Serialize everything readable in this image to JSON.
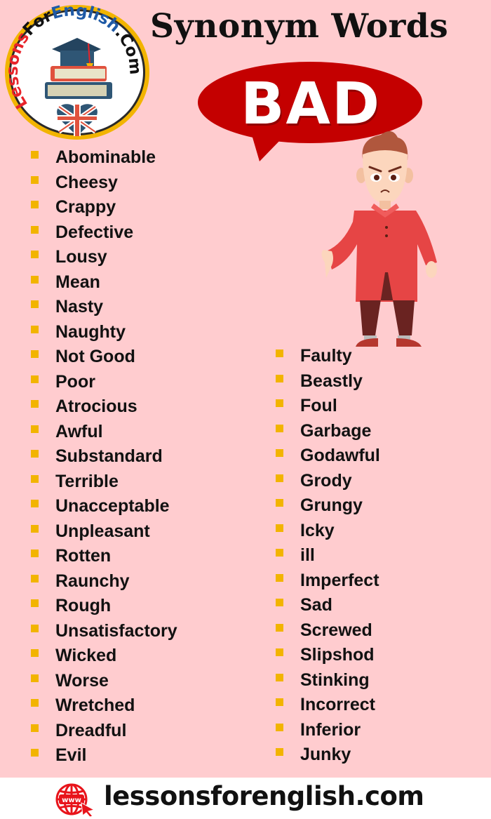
{
  "logo": {
    "text_lessons": "Lessons",
    "text_for": "For",
    "text_english": "English",
    "text_com": ".Com",
    "colors": {
      "lessons": "#e8232a",
      "for": "#111111",
      "english": "#1f5aa6",
      "ring": "#f2b400"
    }
  },
  "header": {
    "title": "Synonym Words",
    "keyword": "BAD",
    "bubble_color": "#c40000"
  },
  "word_lists": {
    "bullet_color": "#f2b400",
    "left": [
      "Abominable",
      "Cheesy",
      "Crappy",
      "Defective",
      "Lousy",
      "Mean",
      "Nasty",
      "Naughty",
      "Not Good",
      "Poor",
      "Atrocious",
      "Awful",
      "Substandard",
      "Terrible",
      "Unacceptable",
      "Unpleasant",
      "Rotten",
      "Raunchy",
      "Rough",
      "Unsatisfactory",
      "Wicked",
      "Worse",
      "Wretched",
      "Dreadful",
      "Evil"
    ],
    "right": [
      "Faulty",
      "Beastly",
      "Foul",
      "Garbage",
      "Godawful",
      "Grody",
      "Grungy",
      "Icky",
      "ill",
      "Imperfect",
      "Sad",
      "Screwed",
      "Slipshod",
      "Stinking",
      "Incorrect",
      "Inferior",
      "Junky"
    ]
  },
  "footer": {
    "website": "lessonsforenglish.com",
    "icon": "www-globe-cursor-icon",
    "icon_label": "www",
    "icon_color": "#e8141b"
  }
}
